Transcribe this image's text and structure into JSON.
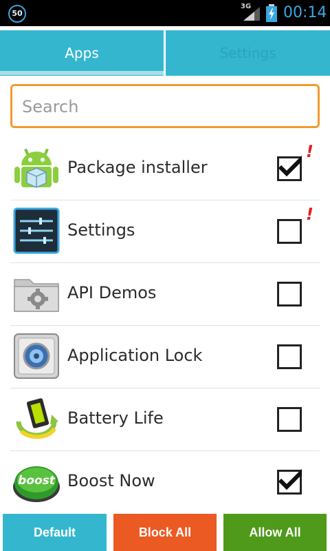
{
  "status_bar": {
    "badge": "50",
    "network": "3G",
    "time": "00:14"
  },
  "tabs": [
    {
      "label": "Apps",
      "active": true
    },
    {
      "label": "Settings",
      "active": false
    }
  ],
  "search": {
    "placeholder": "Search",
    "value": ""
  },
  "apps": [
    {
      "name": "Package installer",
      "checked": true,
      "warning": true,
      "icon": "android-package-icon"
    },
    {
      "name": "Settings",
      "checked": false,
      "warning": true,
      "icon": "settings-sliders-icon"
    },
    {
      "name": "API Demos",
      "checked": false,
      "warning": false,
      "icon": "folder-gear-icon"
    },
    {
      "name": "Application Lock",
      "checked": false,
      "warning": false,
      "icon": "safe-lock-icon"
    },
    {
      "name": "Battery Life",
      "checked": false,
      "warning": false,
      "icon": "battery-recycle-icon"
    },
    {
      "name": "Boost Now",
      "checked": true,
      "warning": false,
      "icon": "boost-button-icon"
    }
  ],
  "warning_mark": "!",
  "buttons": {
    "default_label": "Default",
    "block_all_label": "Block All",
    "allow_all_label": "Allow All"
  },
  "colors": {
    "tab": "#35b6cf",
    "search_border": "#f39a2c",
    "default_btn": "#35b6cf",
    "block_btn": "#ec5a24",
    "allow_btn": "#4f9a1a",
    "warning": "#e02020"
  }
}
